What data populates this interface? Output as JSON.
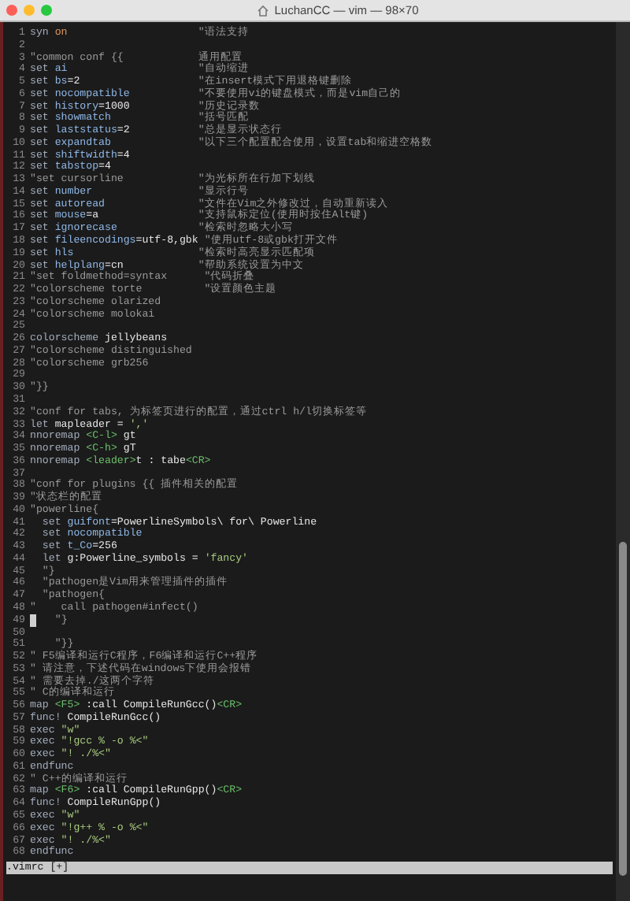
{
  "window": {
    "title": "LuchanCC — vim — 98×70"
  },
  "lines": [
    {
      "number": "1",
      "cursor": false,
      "segments": [
        {
          "text": "syn ",
          "kind": "k"
        },
        {
          "text": "on",
          "kind": "v"
        },
        {
          "text": "                     \"语法支持",
          "kind": "c"
        }
      ]
    },
    {
      "number": "2",
      "cursor": false
    },
    {
      "number": "3",
      "cursor": false,
      "segments": [
        {
          "text": "\"common conf {{            通用配置",
          "kind": "c"
        }
      ]
    },
    {
      "number": "4",
      "cursor": false,
      "segments": [
        {
          "text": "set ",
          "kind": "k"
        },
        {
          "text": "ai",
          "kind": "o"
        },
        {
          "text": "                     \"自动缩进",
          "kind": "c"
        }
      ]
    },
    {
      "number": "5",
      "cursor": false,
      "segments": [
        {
          "text": "set ",
          "kind": "k"
        },
        {
          "text": "bs",
          "kind": "o"
        },
        {
          "text": "=2",
          "kind": "p"
        },
        {
          "text": "                   \"在insert模式下用退格键删除",
          "kind": "c"
        }
      ]
    },
    {
      "number": "6",
      "cursor": false,
      "segments": [
        {
          "text": "set ",
          "kind": "k"
        },
        {
          "text": "nocompatible",
          "kind": "o"
        },
        {
          "text": "           \"不要使用vi的键盘模式，而是vim自己的",
          "kind": "c"
        }
      ]
    },
    {
      "number": "7",
      "cursor": false,
      "segments": [
        {
          "text": "set ",
          "kind": "k"
        },
        {
          "text": "history",
          "kind": "o"
        },
        {
          "text": "=1000",
          "kind": "p"
        },
        {
          "text": "           \"历史记录数",
          "kind": "c"
        }
      ]
    },
    {
      "number": "8",
      "cursor": false,
      "segments": [
        {
          "text": "set ",
          "kind": "k"
        },
        {
          "text": "showmatch",
          "kind": "o"
        },
        {
          "text": "              \"括号匹配",
          "kind": "c"
        }
      ]
    },
    {
      "number": "9",
      "cursor": false,
      "segments": [
        {
          "text": "set ",
          "kind": "k"
        },
        {
          "text": "laststatus",
          "kind": "o"
        },
        {
          "text": "=2",
          "kind": "p"
        },
        {
          "text": "           \"总是显示状态行",
          "kind": "c"
        }
      ]
    },
    {
      "number": "10",
      "cursor": false,
      "segments": [
        {
          "text": "set ",
          "kind": "k"
        },
        {
          "text": "expandtab",
          "kind": "o"
        },
        {
          "text": "              \"以下三个配置配合使用，设置tab和缩进空格数",
          "kind": "c"
        }
      ]
    },
    {
      "number": "11",
      "cursor": false,
      "segments": [
        {
          "text": "set ",
          "kind": "k"
        },
        {
          "text": "shiftwidth",
          "kind": "o"
        },
        {
          "text": "=4",
          "kind": "p"
        }
      ]
    },
    {
      "number": "12",
      "cursor": false,
      "segments": [
        {
          "text": "set ",
          "kind": "k"
        },
        {
          "text": "tabstop",
          "kind": "o"
        },
        {
          "text": "=4",
          "kind": "p"
        }
      ]
    },
    {
      "number": "13",
      "cursor": false,
      "segments": [
        {
          "text": "\"set cursorline            \"为光标所在行加下划线",
          "kind": "c"
        }
      ]
    },
    {
      "number": "14",
      "cursor": false,
      "segments": [
        {
          "text": "set ",
          "kind": "k"
        },
        {
          "text": "number",
          "kind": "o"
        },
        {
          "text": "                 \"显示行号",
          "kind": "c"
        }
      ]
    },
    {
      "number": "15",
      "cursor": false,
      "segments": [
        {
          "text": "set ",
          "kind": "k"
        },
        {
          "text": "autoread",
          "kind": "o"
        },
        {
          "text": "               \"文件在Vim之外修改过，自动重新读入",
          "kind": "c"
        }
      ]
    },
    {
      "number": "16",
      "cursor": false,
      "segments": [
        {
          "text": "set ",
          "kind": "k"
        },
        {
          "text": "mouse",
          "kind": "o"
        },
        {
          "text": "=a",
          "kind": "p"
        },
        {
          "text": "                \"支持鼠标定位(使用时按住Alt键)",
          "kind": "c"
        }
      ]
    },
    {
      "number": "17",
      "cursor": false,
      "segments": [
        {
          "text": "set ",
          "kind": "k"
        },
        {
          "text": "ignorecase",
          "kind": "o"
        },
        {
          "text": "             \"检索时忽略大小写",
          "kind": "c"
        }
      ]
    },
    {
      "number": "18",
      "cursor": false,
      "segments": [
        {
          "text": "set ",
          "kind": "k"
        },
        {
          "text": "fileencodings",
          "kind": "o"
        },
        {
          "text": "=utf-8,gbk",
          "kind": "p"
        },
        {
          "text": " \"使用utf-8或gbk打开文件",
          "kind": "c"
        }
      ]
    },
    {
      "number": "19",
      "cursor": false,
      "segments": [
        {
          "text": "set ",
          "kind": "k"
        },
        {
          "text": "hls",
          "kind": "o"
        },
        {
          "text": "                    \"检索时高亮显示匹配项",
          "kind": "c"
        }
      ]
    },
    {
      "number": "20",
      "cursor": false,
      "segments": [
        {
          "text": "set ",
          "kind": "k"
        },
        {
          "text": "helplang",
          "kind": "o"
        },
        {
          "text": "=cn",
          "kind": "p"
        },
        {
          "text": "            \"帮助系统设置为中文",
          "kind": "c"
        }
      ]
    },
    {
      "number": "21",
      "cursor": false,
      "segments": [
        {
          "text": "\"set foldmethod=syntax      \"代码折叠",
          "kind": "c"
        }
      ]
    },
    {
      "number": "22",
      "cursor": false,
      "segments": [
        {
          "text": "\"colorscheme torte          \"设置颜色主题",
          "kind": "c"
        }
      ]
    },
    {
      "number": "23",
      "cursor": false,
      "segments": [
        {
          "text": "\"colorscheme olarized",
          "kind": "c"
        }
      ]
    },
    {
      "number": "24",
      "cursor": false,
      "segments": [
        {
          "text": "\"colorscheme molokai",
          "kind": "c"
        }
      ]
    },
    {
      "number": "25",
      "cursor": false
    },
    {
      "number": "26",
      "cursor": false,
      "segments": [
        {
          "text": "colorscheme ",
          "kind": "k"
        },
        {
          "text": "jellybeans",
          "kind": "p"
        }
      ]
    },
    {
      "number": "27",
      "cursor": false,
      "segments": [
        {
          "text": "\"colorscheme distinguished",
          "kind": "c"
        }
      ]
    },
    {
      "number": "28",
      "cursor": false,
      "segments": [
        {
          "text": "\"colorscheme grb256",
          "kind": "c"
        }
      ]
    },
    {
      "number": "29",
      "cursor": false
    },
    {
      "number": "30",
      "cursor": false,
      "segments": [
        {
          "text": "\"}}",
          "kind": "c"
        }
      ]
    },
    {
      "number": "31",
      "cursor": false
    },
    {
      "number": "32",
      "cursor": false,
      "segments": [
        {
          "text": "\"conf for tabs, 为标签页进行的配置，通过ctrl h/l切换标签等",
          "kind": "c"
        }
      ]
    },
    {
      "number": "33",
      "cursor": false,
      "segments": [
        {
          "text": "let ",
          "kind": "k"
        },
        {
          "text": "mapleader = ",
          "kind": "p"
        },
        {
          "text": "','",
          "kind": "s"
        }
      ]
    },
    {
      "number": "34",
      "cursor": false,
      "segments": [
        {
          "text": "nnoremap ",
          "kind": "k"
        },
        {
          "text": "<C-l>",
          "kind": "m"
        },
        {
          "text": " gt",
          "kind": "p"
        }
      ]
    },
    {
      "number": "35",
      "cursor": false,
      "segments": [
        {
          "text": "nnoremap ",
          "kind": "k"
        },
        {
          "text": "<C-h>",
          "kind": "m"
        },
        {
          "text": " gT",
          "kind": "p"
        }
      ]
    },
    {
      "number": "36",
      "cursor": false,
      "segments": [
        {
          "text": "nnoremap ",
          "kind": "k"
        },
        {
          "text": "<leader>",
          "kind": "m"
        },
        {
          "text": "t : tabe",
          "kind": "p"
        },
        {
          "text": "<CR>",
          "kind": "m"
        }
      ]
    },
    {
      "number": "37",
      "cursor": false
    },
    {
      "number": "38",
      "cursor": false,
      "segments": [
        {
          "text": "\"conf for plugins {{ 插件相关的配置",
          "kind": "c"
        }
      ]
    },
    {
      "number": "39",
      "cursor": false,
      "segments": [
        {
          "text": "\"状态栏的配置",
          "kind": "c"
        }
      ]
    },
    {
      "number": "40",
      "cursor": false,
      "segments": [
        {
          "text": "\"powerline{",
          "kind": "c"
        }
      ]
    },
    {
      "number": "41",
      "cursor": false,
      "segments": [
        {
          "text": "  set ",
          "kind": "k"
        },
        {
          "text": "guifont",
          "kind": "o"
        },
        {
          "text": "=PowerlineSymbols\\ for\\ Powerline",
          "kind": "p"
        }
      ]
    },
    {
      "number": "42",
      "cursor": false,
      "segments": [
        {
          "text": "  set ",
          "kind": "k"
        },
        {
          "text": "nocompatible",
          "kind": "o"
        }
      ]
    },
    {
      "number": "43",
      "cursor": false,
      "segments": [
        {
          "text": "  set ",
          "kind": "k"
        },
        {
          "text": "t_Co",
          "kind": "o"
        },
        {
          "text": "=256",
          "kind": "p"
        }
      ]
    },
    {
      "number": "44",
      "cursor": false,
      "segments": [
        {
          "text": "  let ",
          "kind": "k"
        },
        {
          "text": "g:Powerline_symbols = ",
          "kind": "p"
        },
        {
          "text": "'fancy'",
          "kind": "s"
        }
      ]
    },
    {
      "number": "45",
      "cursor": false,
      "segments": [
        {
          "text": "  \"}",
          "kind": "c"
        }
      ]
    },
    {
      "number": "46",
      "cursor": false,
      "segments": [
        {
          "text": "  \"pathogen是Vim用来管理插件的插件",
          "kind": "c"
        }
      ]
    },
    {
      "number": "47",
      "cursor": false,
      "segments": [
        {
          "text": "  \"pathogen{",
          "kind": "c"
        }
      ]
    },
    {
      "number": "48",
      "cursor": false,
      "segments": [
        {
          "text": "\"    call pathogen#infect()",
          "kind": "c"
        }
      ]
    },
    {
      "number": "49",
      "cursor": true,
      "segments": [
        {
          "text": "   \"}",
          "kind": "c"
        }
      ]
    },
    {
      "number": "50",
      "cursor": false
    },
    {
      "number": "51",
      "cursor": false,
      "segments": [
        {
          "text": "    \"}}",
          "kind": "c"
        }
      ]
    },
    {
      "number": "52",
      "cursor": false,
      "segments": [
        {
          "text": "\" F5编译和运行C程序，F6编译和运行C++程序",
          "kind": "c"
        }
      ]
    },
    {
      "number": "53",
      "cursor": false,
      "segments": [
        {
          "text": "\" 请注意，下述代码在windows下使用会报错",
          "kind": "c"
        }
      ]
    },
    {
      "number": "54",
      "cursor": false,
      "segments": [
        {
          "text": "\" 需要去掉./这两个字符",
          "kind": "c"
        }
      ]
    },
    {
      "number": "55",
      "cursor": false,
      "segments": [
        {
          "text": "\" C的编译和运行",
          "kind": "c"
        }
      ]
    },
    {
      "number": "56",
      "cursor": false,
      "segments": [
        {
          "text": "map ",
          "kind": "k"
        },
        {
          "text": "<F5>",
          "kind": "m"
        },
        {
          "text": " :call CompileRunGcc()",
          "kind": "p"
        },
        {
          "text": "<CR>",
          "kind": "m"
        }
      ]
    },
    {
      "number": "57",
      "cursor": false,
      "segments": [
        {
          "text": "func! ",
          "kind": "k"
        },
        {
          "text": "CompileRunGcc()",
          "kind": "p"
        }
      ]
    },
    {
      "number": "58",
      "cursor": false,
      "segments": [
        {
          "text": "exec ",
          "kind": "k"
        },
        {
          "text": "\"w\"",
          "kind": "s"
        }
      ]
    },
    {
      "number": "59",
      "cursor": false,
      "segments": [
        {
          "text": "exec ",
          "kind": "k"
        },
        {
          "text": "\"!gcc % -o %<\"",
          "kind": "s"
        }
      ]
    },
    {
      "number": "60",
      "cursor": false,
      "segments": [
        {
          "text": "exec ",
          "kind": "k"
        },
        {
          "text": "\"! ./%<\"",
          "kind": "s"
        }
      ]
    },
    {
      "number": "61",
      "cursor": false,
      "segments": [
        {
          "text": "endfunc",
          "kind": "k"
        }
      ]
    },
    {
      "number": "62",
      "cursor": false,
      "segments": [
        {
          "text": "\" C++的编译和运行",
          "kind": "c"
        }
      ]
    },
    {
      "number": "63",
      "cursor": false,
      "segments": [
        {
          "text": "map ",
          "kind": "k"
        },
        {
          "text": "<F6>",
          "kind": "m"
        },
        {
          "text": " :call CompileRunGpp()",
          "kind": "p"
        },
        {
          "text": "<CR>",
          "kind": "m"
        }
      ]
    },
    {
      "number": "64",
      "cursor": false,
      "segments": [
        {
          "text": "func! ",
          "kind": "k"
        },
        {
          "text": "CompileRunGpp()",
          "kind": "p"
        }
      ]
    },
    {
      "number": "65",
      "cursor": false,
      "segments": [
        {
          "text": "exec ",
          "kind": "k"
        },
        {
          "text": "\"w\"",
          "kind": "s"
        }
      ]
    },
    {
      "number": "66",
      "cursor": false,
      "segments": [
        {
          "text": "exec ",
          "kind": "k"
        },
        {
          "text": "\"!g++ % -o %<\"",
          "kind": "s"
        }
      ]
    },
    {
      "number": "67",
      "cursor": false,
      "segments": [
        {
          "text": "exec ",
          "kind": "k"
        },
        {
          "text": "\"! ./%<\"",
          "kind": "s"
        }
      ]
    },
    {
      "number": "68",
      "cursor": false,
      "segments": [
        {
          "text": "endfunc",
          "kind": "k"
        }
      ]
    }
  ],
  "status_line": ".vimrc [+]"
}
